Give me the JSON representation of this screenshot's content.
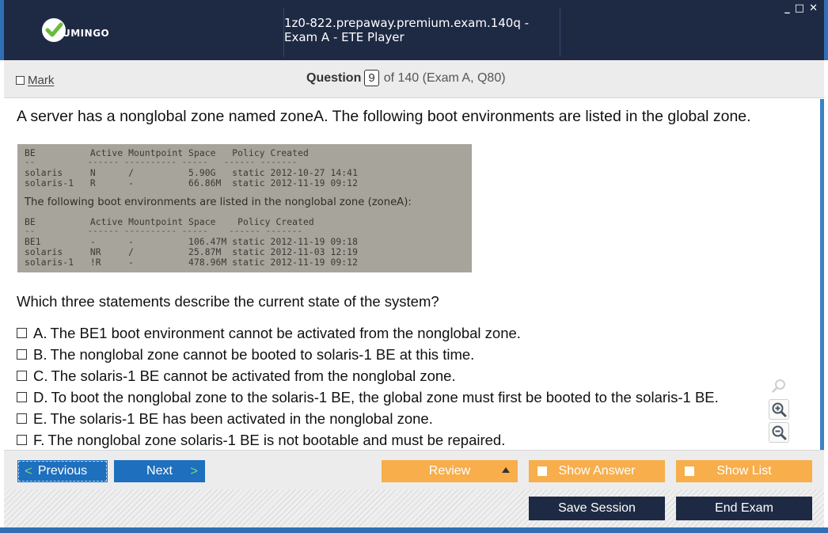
{
  "app": {
    "logo_text": "UMINGO",
    "window_title": "1z0-822.prepaway.premium.exam.140q - Exam A - ETE Player",
    "controls": {
      "minimize": "_",
      "maximize": "□",
      "close": "✕"
    }
  },
  "header": {
    "mark_label": "Mark",
    "question_label": "Question",
    "question_number": "9",
    "question_of": "of 140 (Exam A, Q80)"
  },
  "question": {
    "text": "A server has a nonglobal zone named zoneA. The following boot environments are listed in the global zone.",
    "prompt": "Which three statements describe the current state of the system?",
    "exhibit": {
      "global_header": "BE          Active Mountpoint Space   Policy Created",
      "global_dash": "--          ------ ---------- -----   ------ -------",
      "global_row1": "solaris     N      /          5.90G   static 2012-10-27 14:41",
      "global_row2": "solaris-1   R      -          66.86M  static 2012-11-19 09:12",
      "sentence": "The following boot environments are listed in the nonglobal zone (zoneA):",
      "zone_header": "BE          Active Mountpoint Space    Policy Created",
      "zone_dash": "--          ------ ---------- -----    ------ -------",
      "zone_row1": "BE1         -      -          106.47M static 2012-11-19 09:18",
      "zone_row2": "solaris     NR     /          25.87M  static 2012-11-03 12:19",
      "zone_row3": "solaris-1   !R     -          478.96M static 2012-11-19 09:12"
    },
    "options": [
      {
        "letter": "A.",
        "text": "The BE1 boot environment cannot be activated from the nonglobal zone."
      },
      {
        "letter": "B.",
        "text": "The nonglobal zone cannot be booted to solaris-1 BE at this time."
      },
      {
        "letter": "C.",
        "text": "The solaris-1 BE cannot be activated from the nonglobal zone."
      },
      {
        "letter": "D.",
        "text": "To boot the nonglobal zone to the solaris-1 BE, the global zone must first be booted to the solaris-1 BE."
      },
      {
        "letter": "E.",
        "text": "The solaris-1 BE has been activated in the nonglobal zone."
      },
      {
        "letter": "F.",
        "text": "The nonglobal zone solaris-1 BE is not bootable and must be repaired."
      }
    ]
  },
  "nav": {
    "previous": "Previous",
    "next": "Next",
    "review": "Review",
    "show_answer": "Show Answer",
    "show_list": "Show List",
    "save_session": "Save Session",
    "end_exam": "End Exam"
  },
  "colors": {
    "title_bar": "#1e2a44",
    "accent_blue": "#1e6fbe",
    "accent_orange": "#f7ae4b",
    "logo_green": "#6cbb3c"
  }
}
